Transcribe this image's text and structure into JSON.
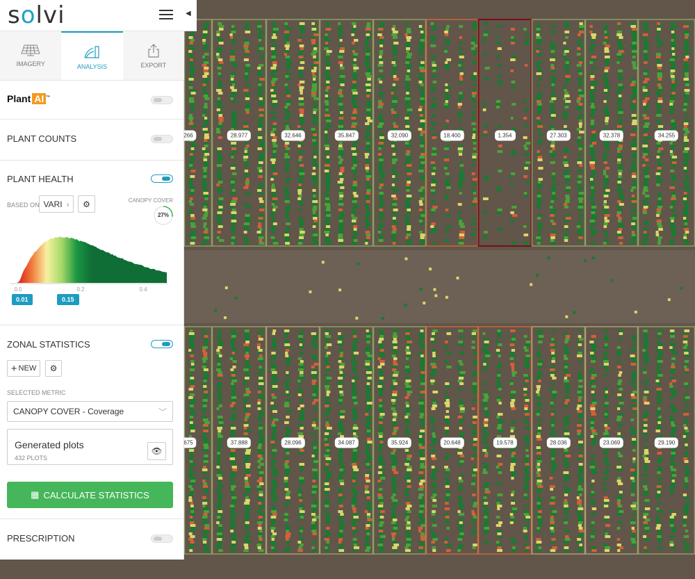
{
  "app": {
    "logo": "solvi"
  },
  "tabs": [
    {
      "label": "IMAGERY",
      "icon": "solar-panel-icon"
    },
    {
      "label": "ANALYSIS",
      "icon": "color-swatch-icon",
      "active": true
    },
    {
      "label": "EXPORT",
      "icon": "share-icon"
    }
  ],
  "plant_ai": {
    "label": "Plant",
    "badge": "AI",
    "tm": "™",
    "enabled": false
  },
  "plant_counts": {
    "title": "PLANT COUNTS",
    "enabled": false
  },
  "plant_health": {
    "title": "PLANT HEALTH",
    "enabled": true,
    "based_on_label": "BASED ON",
    "index": "VARI",
    "canopy_label": "CANOPY COVER",
    "canopy_value": "27%",
    "canopy_fraction": 0.27,
    "histogram": {
      "ticks": [
        "0.0",
        "0.2",
        "0.4"
      ],
      "min_handle": "0.01",
      "max_handle": "0.15"
    }
  },
  "zonal": {
    "title": "ZONAL STATISTICS",
    "enabled": true,
    "new_label": "NEW",
    "metric_label": "SELECTED METRIC",
    "metric_value": "CANOPY COVER - Coverage",
    "plots_title": "Generated plots",
    "plots_count": "432 PLOTS",
    "calculate_label": "CALCULATE STATISTICS"
  },
  "prescription": {
    "title": "PRESCRIPTION",
    "enabled": false
  },
  "map": {
    "top_row": [
      {
        "v": "266",
        "c": "#8aa060"
      },
      {
        "v": "28.977",
        "c": "#8aa060"
      },
      {
        "v": "32.646",
        "c": "#8aa060"
      },
      {
        "v": "35.847",
        "c": "#8aa060"
      },
      {
        "v": "32.090",
        "c": "#8aa060"
      },
      {
        "v": "18.400",
        "c": "#c86a3a"
      },
      {
        "v": "1.354",
        "c": "#7a0f18"
      },
      {
        "v": "27.303",
        "c": "#8aa060"
      },
      {
        "v": "32.378",
        "c": "#8aa060"
      },
      {
        "v": "34.255",
        "c": "#8aa060"
      }
    ],
    "bottom_row": [
      {
        "v": "675",
        "c": "#8aa060"
      },
      {
        "v": "37.888",
        "c": "#8aa060"
      },
      {
        "v": "28.096",
        "c": "#a8a070"
      },
      {
        "v": "34.087",
        "c": "#8aa060"
      },
      {
        "v": "35.924",
        "c": "#8aa060"
      },
      {
        "v": "20.648",
        "c": "#c86a3a"
      },
      {
        "v": "19.578",
        "c": "#c86a3a"
      },
      {
        "v": "28.036",
        "c": "#a8a070"
      },
      {
        "v": "23.069",
        "c": "#a8a070"
      },
      {
        "v": "29.190",
        "c": "#8aa060"
      }
    ]
  }
}
